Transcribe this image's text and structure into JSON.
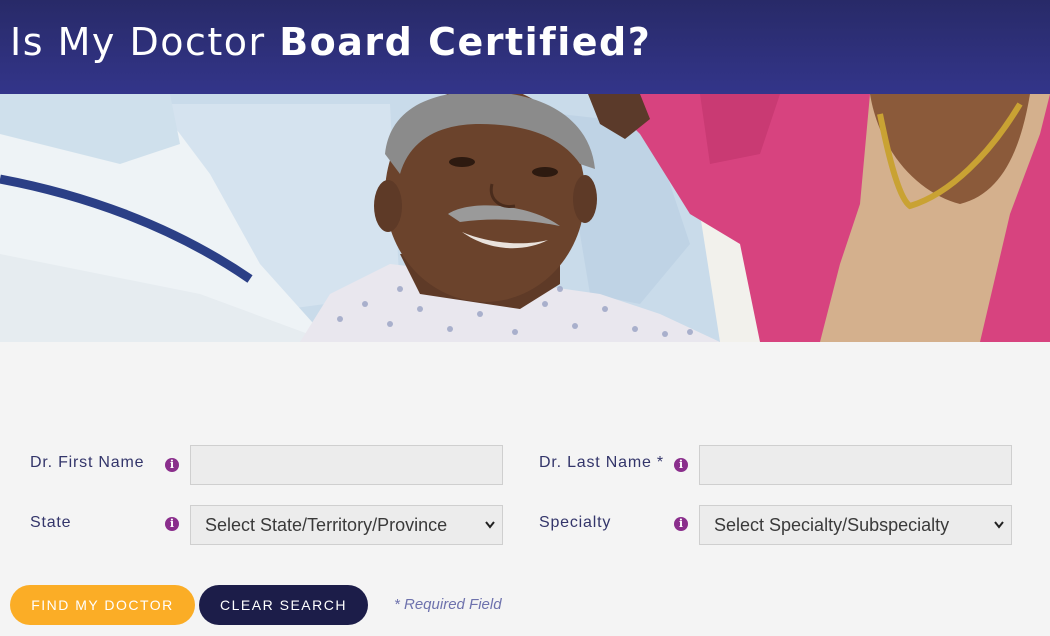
{
  "header": {
    "title_light": "Is My Doctor ",
    "title_bold": "Board Certified?"
  },
  "hero": {
    "alt": "Smiling patient in hospital bed with doctor and visitor"
  },
  "form": {
    "first_name_label": "Dr. First Name",
    "last_name_label": "Dr. Last Name *",
    "state_label": "State",
    "specialty_label": "Specialty",
    "info_glyph": "i",
    "first_name_value": "",
    "last_name_value": "",
    "state_selected": "Select State/Territory/Province",
    "specialty_selected": "Select Specialty/Subspecialty"
  },
  "actions": {
    "find_label": "FIND MY DOCTOR",
    "clear_label": "CLEAR SEARCH",
    "required_note": "* Required Field"
  },
  "colors": {
    "header": "#2d2f78",
    "find_button": "#fbad26",
    "clear_button": "#1c1d49",
    "info_icon": "#8a2e8c"
  }
}
